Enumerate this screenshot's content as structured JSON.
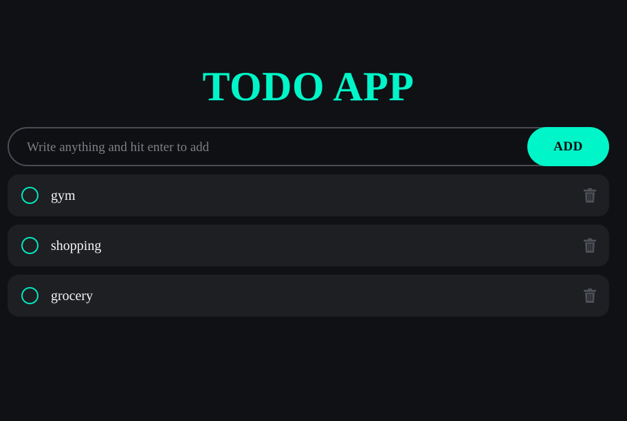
{
  "app": {
    "title": "TODO APP"
  },
  "input": {
    "placeholder": "Write anything and hit enter to add",
    "value": ""
  },
  "add_button": {
    "label": "ADD"
  },
  "todos": [
    {
      "text": "gym",
      "completed": false,
      "delete_icon": "trash-icon"
    },
    {
      "text": "shopping",
      "completed": false,
      "delete_icon": "trash-icon"
    },
    {
      "text": "grocery",
      "completed": false,
      "delete_icon": "trash-icon"
    }
  ],
  "colors": {
    "background": "#0f1115",
    "accent": "#00f5c8",
    "item_background": "#1d1f23",
    "input_border": "#4a4d53",
    "text": "#f4f4f4",
    "placeholder": "#7d7f84",
    "icon_muted": "#4d5057"
  }
}
